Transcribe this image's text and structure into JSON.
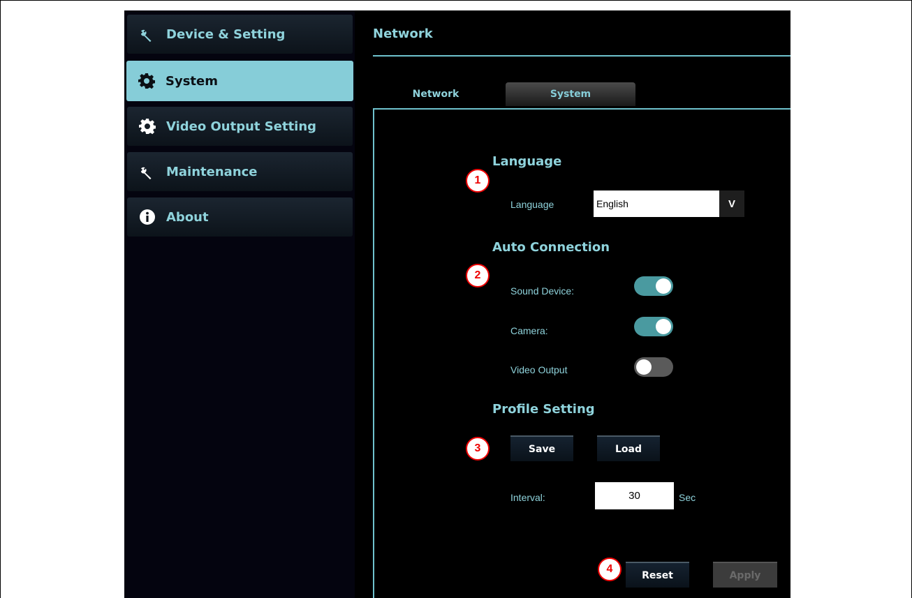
{
  "sidebar": {
    "items": [
      {
        "label": "Device & Setting",
        "icon": "wrench-icon"
      },
      {
        "label": "System",
        "icon": "gear-icon",
        "active": true
      },
      {
        "label": "Video Output Setting",
        "icon": "gear-icon"
      },
      {
        "label": "Maintenance",
        "icon": "wrench-icon"
      },
      {
        "label": "About",
        "icon": "info-icon"
      }
    ]
  },
  "main": {
    "title": "Network",
    "tabs": [
      {
        "label": "Network"
      },
      {
        "label": "System",
        "active": true
      }
    ]
  },
  "language": {
    "section_title": "Language",
    "field_label": "Language",
    "selected": "English",
    "arrow": "V"
  },
  "auto_connection": {
    "section_title": "Auto Connection",
    "items": [
      {
        "label": "Sound Device:",
        "on": true
      },
      {
        "label": "Camera:",
        "on": true
      },
      {
        "label": "Video Output",
        "on": false
      }
    ]
  },
  "profile": {
    "section_title": "Profile Setting",
    "save_label": "Save",
    "load_label": "Load",
    "interval_label": "Interval:",
    "interval_value": "30",
    "interval_unit": "Sec"
  },
  "actions": {
    "reset_label": "Reset",
    "apply_label": "Apply"
  },
  "markers": [
    "1",
    "2",
    "3",
    "4"
  ],
  "colors": {
    "accent": "#86cdd8",
    "marker": "#e00000",
    "toggle_on": "#4a9aa0",
    "toggle_off": "#5a5a5a"
  }
}
